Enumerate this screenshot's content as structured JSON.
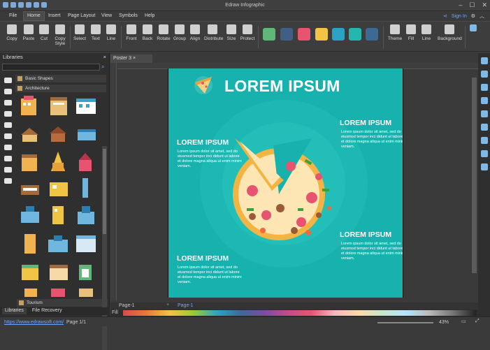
{
  "window": {
    "title": "Edraw Infographic"
  },
  "menu": {
    "items": [
      "File",
      "Home",
      "Insert",
      "Page Layout",
      "View",
      "Symbols",
      "Help"
    ],
    "active": "Home",
    "sign_in": "Sign In"
  },
  "ribbon": {
    "buttons": [
      "Copy",
      "Paste",
      "Cut",
      "Copy Style",
      "Select",
      "Text",
      "Line",
      "Front",
      "Back",
      "Rotate",
      "Group",
      "Align",
      "Distribute",
      "Size",
      "Protect",
      "Theme",
      "Fill",
      "Line",
      "Background"
    ],
    "swatches": [
      "#5fb87a",
      "#3f5f87",
      "#e8546f",
      "#f2c445",
      "#2ba3c4",
      "#23b7ae",
      "#3c6a93"
    ]
  },
  "libraries": {
    "title": "Libraries",
    "search_placeholder": "",
    "categories": [
      "Basic Shapes",
      "Architecture"
    ],
    "bottom_category": "Tourism",
    "tabs": [
      "Libraries",
      "File Recovery"
    ]
  },
  "document": {
    "tab": "Poster 3"
  },
  "poster": {
    "title": "LOREM IPSUM",
    "headings": [
      "LOREM IPSUM",
      "LOREM IPSUM",
      "LOREM IPSUM",
      "LOREM IPSUM"
    ],
    "body": "Lorem ipsum dolor sit amet, sed do eiusmod tempor inci didunt ut labore et dolore magna aliqua ut enim minim veniam."
  },
  "pagebar": {
    "page_tab": "Page-1",
    "page_current": "Page-1",
    "fill_label": "Fill"
  },
  "status": {
    "url": "https://www.edrawsoft.com/",
    "page": "Page 1/1",
    "zoom": "43%"
  },
  "colors": {
    "poster_bg": "#17b2ad",
    "accent": "#6fa8ff"
  }
}
